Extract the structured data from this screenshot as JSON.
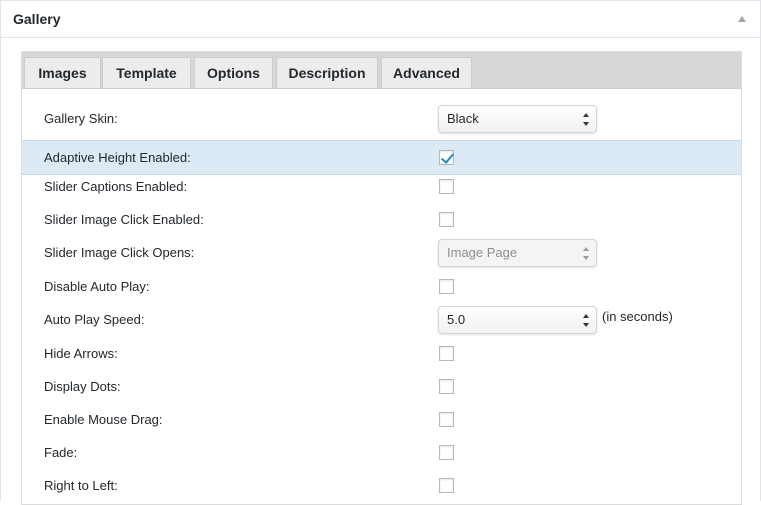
{
  "metabox": {
    "title": "Gallery"
  },
  "tabs": [
    "Images",
    "Template",
    "Options",
    "Description",
    "Advanced"
  ],
  "active_tab": "Options",
  "fields": {
    "gallery_skin": {
      "label": "Gallery Skin:",
      "value": "Black"
    },
    "adaptive_height": {
      "label": "Adaptive Height Enabled:",
      "checked": true
    },
    "slider_captions": {
      "label": "Slider Captions Enabled:",
      "checked": false
    },
    "slider_image_click": {
      "label": "Slider Image Click Enabled:",
      "checked": false
    },
    "slider_image_click_opens": {
      "label": "Slider Image Click Opens:",
      "value": "Image Page",
      "disabled": true
    },
    "disable_auto_play": {
      "label": "Disable Auto Play:",
      "checked": false
    },
    "auto_play_speed": {
      "label": "Auto Play Speed:",
      "value": "5.0",
      "suffix": "(in seconds)"
    },
    "hide_arrows": {
      "label": "Hide Arrows:",
      "checked": false
    },
    "display_dots": {
      "label": "Display Dots:",
      "checked": false
    },
    "enable_mouse_drag": {
      "label": "Enable Mouse Drag:",
      "checked": false
    },
    "fade": {
      "label": "Fade:",
      "checked": false
    },
    "right_to_left": {
      "label": "Right to Left:",
      "checked": false
    }
  },
  "colors": {
    "highlight_row": "#dceaf5",
    "checkmark": "#1e8cbe",
    "tabbar": "#d7d7d7"
  },
  "icons": {
    "collapse_toggle": "triangle-up-icon",
    "select_arrows": "up-down-arrows-icon",
    "checkmark": "checkmark-icon"
  }
}
